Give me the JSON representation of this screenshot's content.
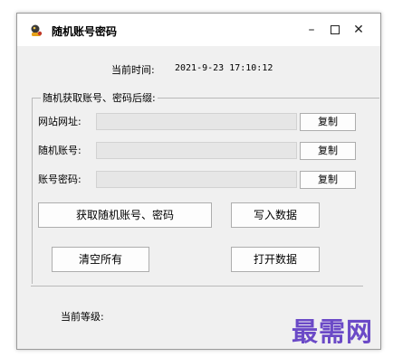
{
  "window": {
    "title": "随机账号密码",
    "controls": {
      "minimize": "–",
      "close": "✕"
    }
  },
  "header": {
    "time_label": "当前时间:",
    "time_value": "2021-9-23 17:10:12"
  },
  "group": {
    "title": "随机获取账号、密码后缀:",
    "fields": [
      {
        "label": "网站网址:",
        "value": "",
        "copy_label": "复制"
      },
      {
        "label": "随机账号:",
        "value": "",
        "copy_label": "复制"
      },
      {
        "label": "账号密码:",
        "value": "",
        "copy_label": "复制"
      }
    ]
  },
  "actions": {
    "fetch_label": "获取随机账号、密码",
    "write_label": "写入数据",
    "clear_label": "清空所有",
    "open_label": "打开数据"
  },
  "footer": {
    "level_label": "当前等级:"
  },
  "watermark": "最需网",
  "colors": {
    "watermark": "#6b4ac7",
    "window_bg": "#f0f0f0",
    "input_bg": "#e6e6e6"
  }
}
